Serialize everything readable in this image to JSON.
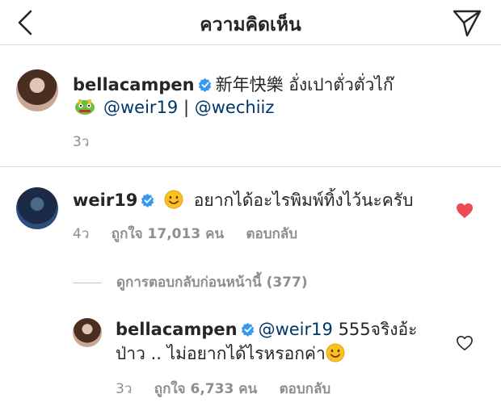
{
  "header": {
    "title": "ความคิดเห็น",
    "back_icon": "chevron-left-icon",
    "send_icon": "paper-plane-icon"
  },
  "caption": {
    "username": "bellacampen",
    "text": "新年快樂 อั่งเปาตั่วตั่วไก๊",
    "emoji": "dragon-emoji",
    "mention_1": "@weir19",
    "separator": "|",
    "mention_2": "@wechiiz",
    "time": "3ว"
  },
  "comment": {
    "username": "weir19",
    "emoji": "smiling-face-emoji",
    "text": "อยากได้อะไรพิมพ์ทิ้งไว้นะครับ",
    "time": "4ว",
    "likes": "ถูกใจ 17,013 คน",
    "reply_label": "ตอบกลับ",
    "liked": true,
    "liked_color": "#ed4956"
  },
  "view_previous_replies": "ดูการตอบกลับก่อนหน้านี้ (377)",
  "reply": {
    "username": "bellacampen",
    "mention": "@weir19",
    "text_line1": "555จริงอ้ะ",
    "text_line2": "ป่าว .. ไม่อยากได้ไรหรอกค่า",
    "emoji": "smiling-face-emoji",
    "time": "3ว",
    "likes": "ถูกใจ 6,733 คน",
    "reply_label": "ตอบกลับ",
    "liked": false
  },
  "colors": {
    "verified": "#3897f0",
    "mention": "#00376b",
    "meta": "#8e8e8e",
    "heart": "#ed4956"
  }
}
